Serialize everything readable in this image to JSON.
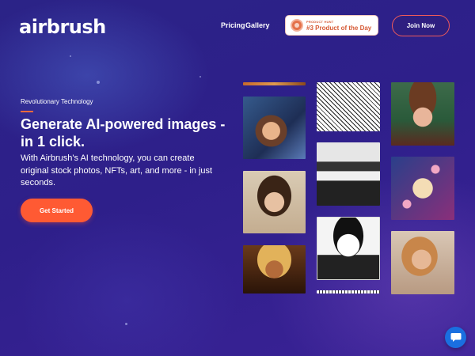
{
  "brand": {
    "logo_text": "airbrush"
  },
  "nav": {
    "links": [
      {
        "label": "Pricing"
      },
      {
        "label": "Gallery"
      }
    ],
    "product_hunt": {
      "small_text": "PRODUCT HUNT",
      "big_text": "#3 Product of the Day",
      "color": "#d65a35"
    },
    "join_label": "Join Now"
  },
  "hero": {
    "eyebrow": "Revolutionary Technology",
    "headline": "Generate AI-powered images - in 1 click.",
    "subtext": "With Airbrush's AI technology, you can create original stock photos, NFTs, art, and more - in just seconds.",
    "cta_label": "Get Started",
    "accent_color": "#ff5a33"
  },
  "gallery": {
    "images": [
      {
        "name": "portrait-partial-top"
      },
      {
        "name": "fantasy-elf-girl"
      },
      {
        "name": "brunette-portrait"
      },
      {
        "name": "golden-headdress-portrait"
      },
      {
        "name": "comic-characters"
      },
      {
        "name": "black-white-room"
      },
      {
        "name": "comic-man-portrait"
      },
      {
        "name": "comic-partial-bottom"
      },
      {
        "name": "woman-with-hat"
      },
      {
        "name": "cat-on-flower"
      },
      {
        "name": "blonde-woman-portrait"
      }
    ]
  },
  "chat": {
    "icon": "chat-bubble-icon",
    "color": "#1a6fe0"
  }
}
